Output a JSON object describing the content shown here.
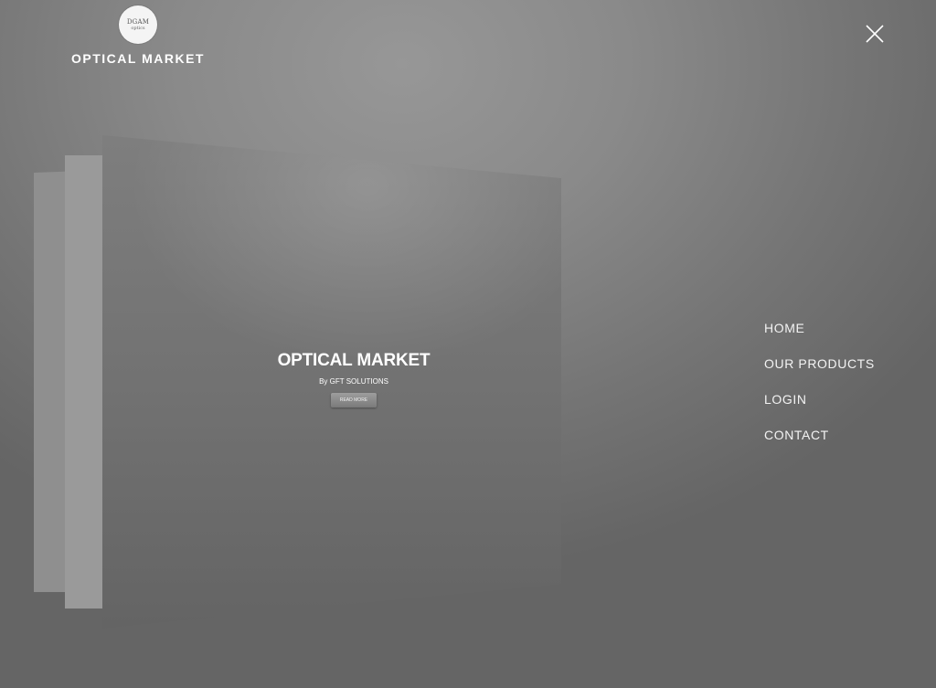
{
  "header": {
    "logo_mark_top": "DGAM",
    "logo_mark_bottom": "optics",
    "brand_title": "OPTICAL MARKET"
  },
  "slide": {
    "title": "OPTICAL MARKET",
    "subtitle": "By GFT SOLUTIONS",
    "button_label": "READ MORE"
  },
  "nav": {
    "items": [
      {
        "label": "HOME"
      },
      {
        "label": "OUR PRODUCTS"
      },
      {
        "label": "LOGIN"
      },
      {
        "label": "CONTACT"
      }
    ]
  },
  "icons": {
    "close": "close-icon"
  },
  "colors": {
    "background": "#8a8a8a",
    "text": "#ffffff"
  }
}
